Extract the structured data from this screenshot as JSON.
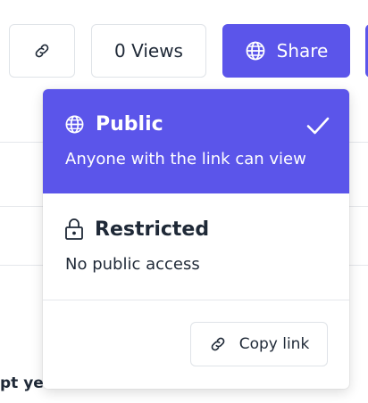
{
  "toolbar": {
    "link_button_icon": "link-icon",
    "views_label": "0 Views",
    "share_label": "Share",
    "share_icon": "globe-icon",
    "accent_color": "#5b55ea"
  },
  "background": {
    "partial_text": "pt yet"
  },
  "share_menu": {
    "options": [
      {
        "title": "Public",
        "description": "Anyone with the link can view",
        "icon": "globe-icon",
        "selected": true
      },
      {
        "title": "Restricted",
        "description": "No public access",
        "icon": "lock-icon",
        "selected": false
      }
    ],
    "copy_link_label": "Copy link",
    "copy_link_icon": "link-icon",
    "selected_icon": "checkmark-icon"
  }
}
